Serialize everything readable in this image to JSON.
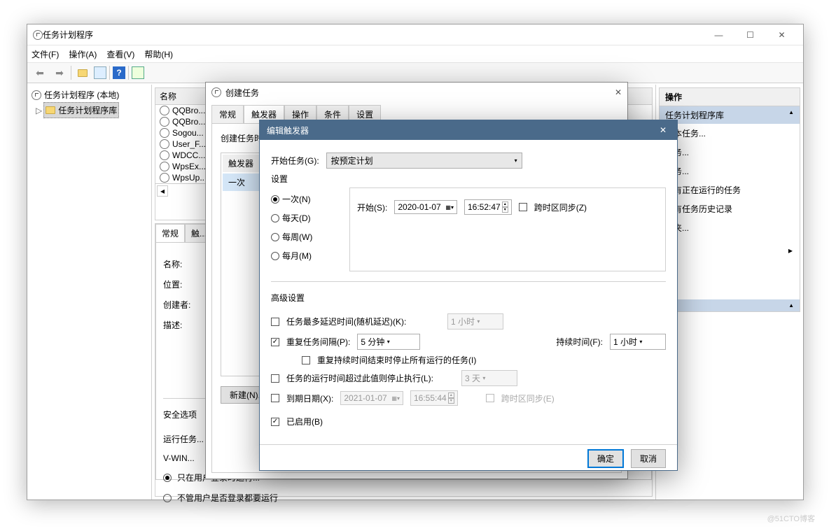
{
  "mainWindow": {
    "title": "任务计划程序",
    "menu": {
      "file": "文件(F)",
      "action": "操作(A)",
      "view": "查看(V)",
      "help": "帮助(H)"
    }
  },
  "tree": {
    "root": "任务计划程序 (本地)",
    "child": "任务计划程序库"
  },
  "taskList": {
    "header": "名称",
    "items": [
      "QQBro...",
      "QQBro...",
      "Sogou...",
      "User_F...",
      "WDCC...",
      "WpsEx...",
      "WpsUp..."
    ]
  },
  "detail": {
    "tabs": {
      "general": "常规",
      "trigger": "触..."
    },
    "name": "名称:",
    "location": "位置:",
    "author": "创建者:",
    "desc": "描述:",
    "secOptions": "安全选项",
    "runLabel": "运行任务...",
    "runUser": "V-WIN...",
    "optLoggedOn": "只在用户登录时运行...",
    "optAnyUser": "不管用户是否登录都要运行"
  },
  "actions": {
    "header": "任务计划程序库",
    "items": [
      "...本任务...",
      "...务...",
      "...务...",
      "...有正在运行的任务",
      "...有任务历史记录",
      "...夹...",
      ""
    ]
  },
  "createDialog": {
    "title": "创建任务",
    "tabs": {
      "general": "常规",
      "triggers": "触发器",
      "actions": "操作",
      "conditions": "条件",
      "settings": "设置"
    },
    "intro": "创建任务时...",
    "colTrigger": "触发器",
    "colDetail": "...",
    "rowTrigger": "一次",
    "newBtn": "新建(N)..."
  },
  "editDialog": {
    "title": "编辑触发器",
    "beginLabel": "开始任务(G):",
    "beginValue": "按预定计划",
    "settingsLabel": "设置",
    "radios": {
      "once": "一次(N)",
      "daily": "每天(D)",
      "weekly": "每周(W)",
      "monthly": "每月(M)"
    },
    "startLabel": "开始(S):",
    "startDate": "2020-01-07",
    "startTime": "16:52:47",
    "syncTz": "跨时区同步(Z)",
    "advLabel": "高级设置",
    "delayLabel": "任务最多延迟时间(随机延迟)(K):",
    "delayValue": "1 小时",
    "repeatLabel": "重复任务间隔(P):",
    "repeatValue": "5 分钟",
    "durationLabel": "持续时间(F):",
    "durationValue": "1 小时",
    "stopAtEnd": "重复持续时间结束时停止所有运行的任务(I)",
    "stopAfterLabel": "任务的运行时间超过此值则停止执行(L):",
    "stopAfterValue": "3 天",
    "expireLabel": "到期日期(X):",
    "expireDate": "2021-01-07",
    "expireTime": "16:55:44",
    "expireSync": "跨时区同步(E)",
    "enabled": "已启用(B)",
    "ok": "确定",
    "cancel": "取消"
  },
  "footer": "@51CTO博客"
}
